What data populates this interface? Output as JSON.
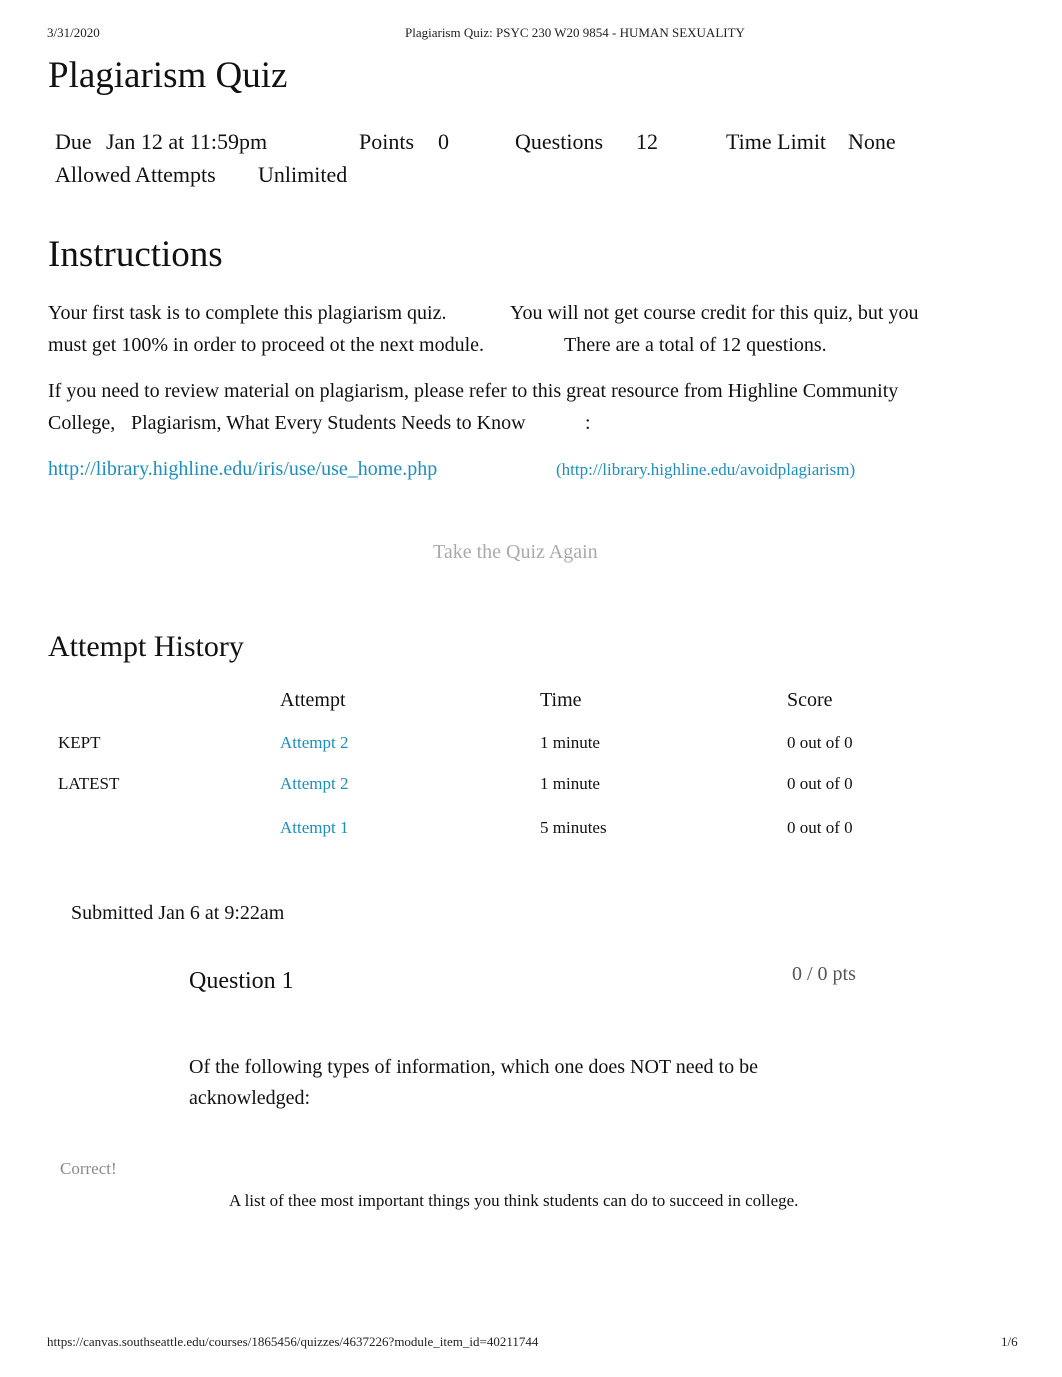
{
  "print_header": {
    "date": "3/31/2020",
    "page_title": "Plagiarism Quiz: PSYC 230 W20 9854 - HUMAN SEXUALITY"
  },
  "quiz": {
    "title": "Plagiarism Quiz",
    "details": {
      "due_label": "Due",
      "due_value": "Jan 12 at 11:59pm",
      "points_label": "Points",
      "points_value": "0",
      "questions_label": "Questions",
      "questions_value": "12",
      "time_limit_label": "Time Limit",
      "time_limit_value": "None",
      "attempts_label": "Allowed Attempts",
      "attempts_value": "Unlimited"
    }
  },
  "instructions": {
    "heading": "Instructions",
    "para1_a": "Your first task is to complete this plagiarism quiz.",
    "para1_b": "You will not get course credit for this quiz, but you must get 100% in order to proceed ot the next module.",
    "para1_c": "There are a total of 12 questions.",
    "para2_a": "If you need to review material on plagiarism, please refer to this great resource from Highline Community College,",
    "para2_b": "Plagiarism, What Every Students Needs to Know",
    "para2_c": ":",
    "link1": "http://library.highline.edu/iris/use/use_home.php",
    "link2": "(http://library.highline.edu/avoidplagiarism)"
  },
  "take_again_button": "Take the Quiz Again",
  "attempt_history": {
    "heading": "Attempt History",
    "columns": [
      "",
      "Attempt",
      "Time",
      "Score"
    ],
    "rows": [
      {
        "tag": "KEPT",
        "attempt": "Attempt 2",
        "time": "1 minute",
        "score": "0 out of 0"
      },
      {
        "tag": "LATEST",
        "attempt": "Attempt 2",
        "time": "1 minute",
        "score": "0 out of 0"
      },
      {
        "tag": "",
        "attempt": "Attempt 1",
        "time": "5 minutes",
        "score": "0 out of 0"
      }
    ]
  },
  "submission": {
    "submitted": "Submitted Jan 6 at 9:22am"
  },
  "question1": {
    "title": "Question 1",
    "points": "0 / 0 pts",
    "text": "Of the following types of information, which one does NOT need to be acknowledged:",
    "result_label": "Correct!",
    "answer": "A list of thee most important things you think students can do to succeed in college."
  },
  "print_footer": {
    "url": "https://canvas.southseattle.edu/courses/1865456/quizzes/4637226?module_item_id=40211744",
    "page": "1/6"
  },
  "colors": {
    "link": "#1a8fc0",
    "muted": "#aaaaaa"
  }
}
